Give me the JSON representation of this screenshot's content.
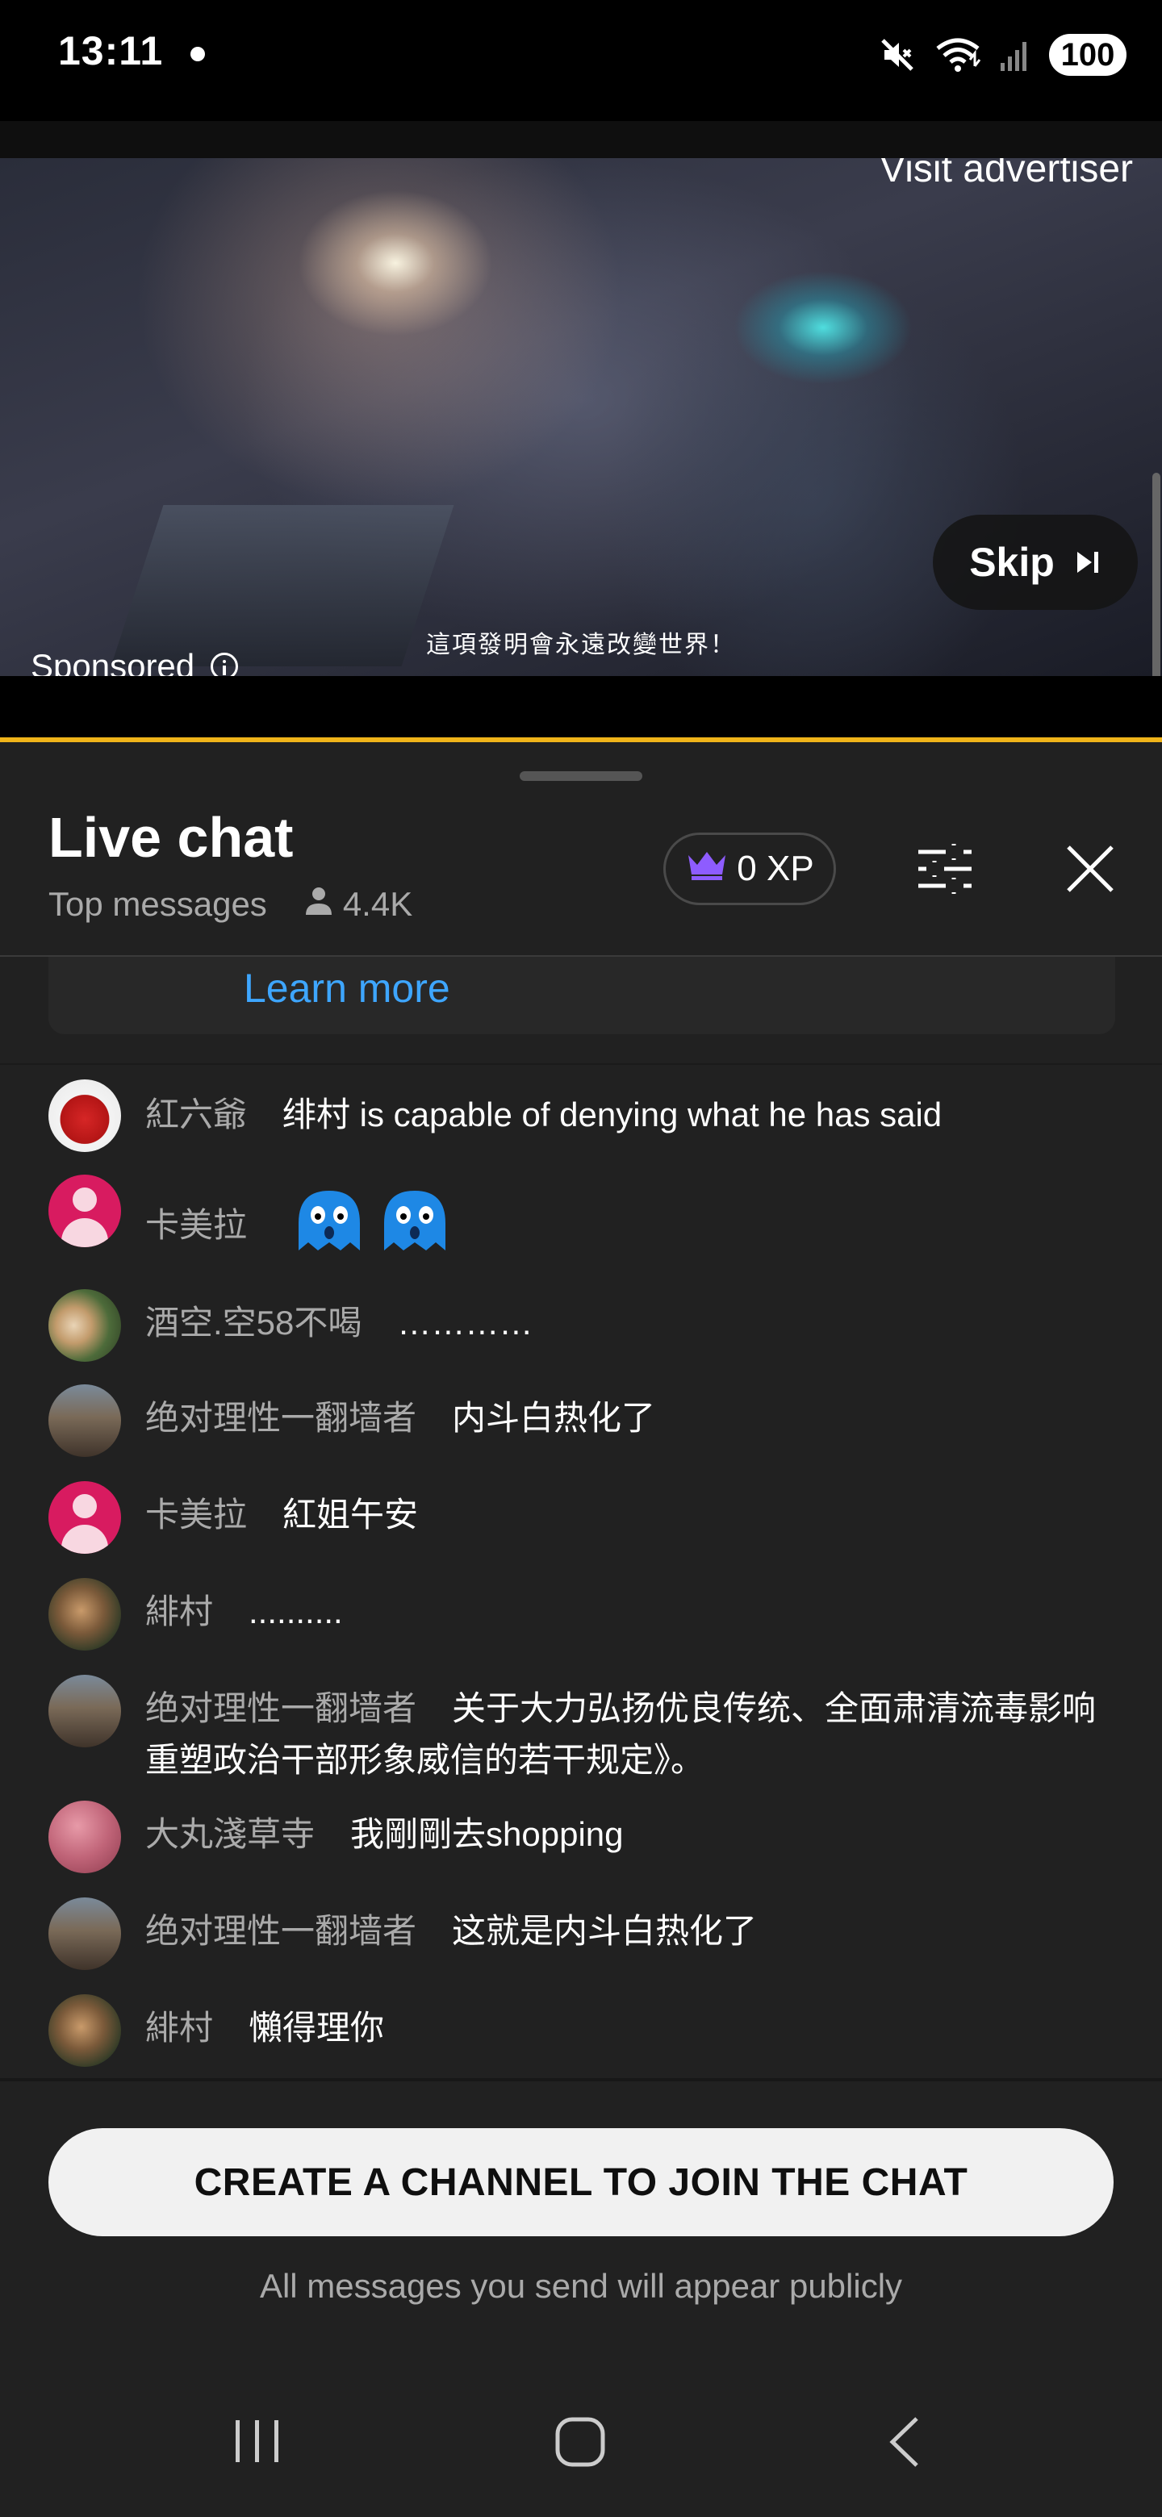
{
  "status_bar": {
    "time": "13:11",
    "battery": "100",
    "icons": [
      "notification-dot",
      "mute-icon",
      "wifi-icon",
      "signal-icon"
    ]
  },
  "ad": {
    "visit_advertiser": "Visit advertiser",
    "subtitle": "這項發明會永遠改變世界！",
    "sponsored": "Sponsored",
    "skip_label": "Skip",
    "progress_color": "#f0b41a"
  },
  "chat": {
    "title": "Live chat",
    "mode": "Top messages",
    "viewer_count": "4.4K",
    "xp": "0 XP",
    "learn_more": "Learn more",
    "accent_color": "#3ea6ff",
    "messages": [
      {
        "author": "紅六爺",
        "text": "绯村 is capable of denying what he has said"
      },
      {
        "author": "卡美拉",
        "text": ""
      },
      {
        "author": "酒空.空58不喝",
        "text": "…………"
      },
      {
        "author": "绝对理性一翻墙者",
        "text": "内斗白热化了"
      },
      {
        "author": "卡美拉",
        "text": "紅姐午安"
      },
      {
        "author": "緋村",
        "text": ".........."
      },
      {
        "author": "绝对理性一翻墙者",
        "text": "关于大力弘扬优良传统、全面肃清流毒影响重塑政治干部形象威信的若干规定》。"
      },
      {
        "author": "大丸淺草寺",
        "text": "我剛剛去shopping"
      },
      {
        "author": "绝对理性一翻墙者",
        "text": "这就是内斗白热化了"
      },
      {
        "author": "緋村",
        "text": "懶得理你"
      }
    ]
  },
  "compose": {
    "button": "CREATE A CHANNEL TO JOIN THE CHAT",
    "note": "All messages you send will appear publicly"
  }
}
